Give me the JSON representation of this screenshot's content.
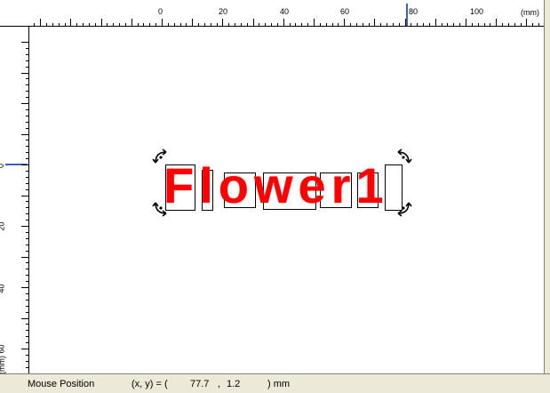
{
  "ruler": {
    "unit_label": "(mm)",
    "top_labels": [
      "0",
      "20",
      "40",
      "60",
      "80",
      "100"
    ],
    "left_labels": [
      "0",
      "20",
      "40",
      "60"
    ]
  },
  "canvas": {
    "text": "Flower1",
    "text_color": "#ff0000"
  },
  "status": {
    "label": "Mouse Position",
    "coords_prefix": "(x, y) = (",
    "x": "77.7",
    "y": "1.2",
    "suffix": ") mm"
  },
  "icons": [
    "rotate-handle-icon"
  ]
}
